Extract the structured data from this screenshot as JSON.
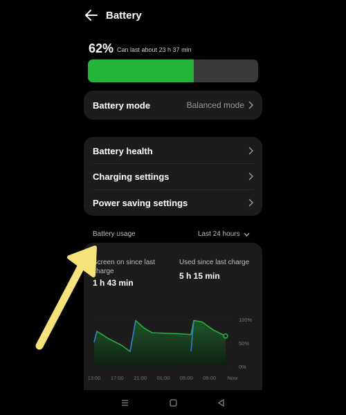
{
  "header": {
    "title": "Battery"
  },
  "battery": {
    "percent": "62%",
    "percent_value": 0.62,
    "remaining": "Can last about 23 h 37 min"
  },
  "mode_card": {
    "label": "Battery mode",
    "value": "Balanced mode"
  },
  "settings": [
    {
      "label": "Battery health"
    },
    {
      "label": "Charging settings"
    },
    {
      "label": "Power saving settings"
    }
  ],
  "usage": {
    "label": "Battery usage",
    "range": "Last 24 hours",
    "screen_on_label": "Screen on since last charge",
    "screen_on_value": "1 h 43 min",
    "used_since_label": "Used since last charge",
    "used_since_value": "5 h 15 min"
  },
  "chart_data": {
    "type": "area",
    "x_ticks": [
      "13:00",
      "17:00",
      "21:00",
      "01:00",
      "05:00",
      "09:00",
      "Now"
    ],
    "y_ticks": [
      "100%",
      "50%",
      "0%"
    ],
    "ylim": [
      0,
      100
    ],
    "series": [
      {
        "points": [
          {
            "t": 0.0,
            "v": 52
          },
          {
            "t": 0.02,
            "v": 75
          },
          {
            "t": 0.06,
            "v": 68
          },
          {
            "t": 0.1,
            "v": 60
          },
          {
            "t": 0.2,
            "v": 45
          },
          {
            "t": 0.26,
            "v": 32
          },
          {
            "t": 0.3,
            "v": 98
          },
          {
            "t": 0.36,
            "v": 82
          },
          {
            "t": 0.42,
            "v": 72
          },
          {
            "t": 0.6,
            "v": 70
          },
          {
            "t": 0.7,
            "v": 68
          },
          {
            "t": 0.72,
            "v": 98
          },
          {
            "t": 0.78,
            "v": 95
          },
          {
            "t": 0.86,
            "v": 78
          },
          {
            "t": 0.95,
            "v": 65
          }
        ]
      }
    ],
    "colors": {
      "line": "#27b43b",
      "charging": "#3a7bd5"
    }
  },
  "nav": {
    "icons": [
      "menu-icon",
      "home-icon",
      "back-icon"
    ]
  }
}
